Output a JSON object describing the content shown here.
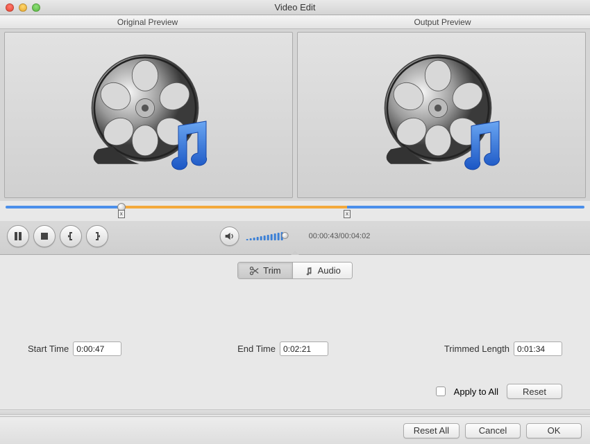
{
  "window": {
    "title": "Video Edit"
  },
  "previews": {
    "original_label": "Original Preview",
    "output_label": "Output Preview"
  },
  "playback": {
    "timecode": "00:00:43/00:04:02"
  },
  "tabs": {
    "trim_label": "Trim",
    "audio_label": "Audio"
  },
  "trim": {
    "start_label": "Start Time",
    "start_value": "0:00:47",
    "end_label": "End Time",
    "end_value": "0:02:21",
    "length_label": "Trimmed Length",
    "length_value": "0:01:34",
    "apply_all_label": "Apply to All",
    "reset_label": "Reset"
  },
  "footer": {
    "reset_all": "Reset All",
    "cancel": "Cancel",
    "ok": "OK"
  }
}
